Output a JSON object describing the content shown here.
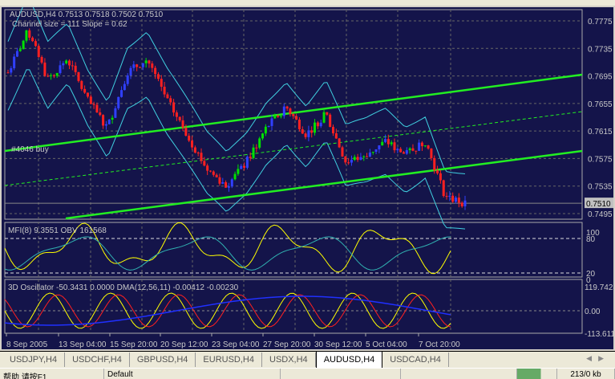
{
  "chart": {
    "header": "AUDUSD,H4  0.7513 0.7518 0.7502 0.7510",
    "subheader": "Channel size = 111 Slope = 0.62",
    "line_label": "#4046 buy",
    "current_price": "0.7510",
    "price_ticks": [
      "0.7775",
      "0.7735",
      "0.7695",
      "0.7655",
      "0.7615",
      "0.7575",
      "0.7535",
      "0.7495"
    ],
    "mfi_header": "MFI(8) 9.3551  OBV 161568",
    "mfi_ticks": [
      "100",
      "80",
      "20",
      "0"
    ],
    "osc_header": "3D Oscillator -50.3431 0.0000  DMA(12,56,11) -0.00412 -0.00230",
    "osc_ticks": [
      "119.7428",
      "0.00",
      "-113.611"
    ],
    "time_ticks": [
      "8 Sep 2005",
      "13 Sep 04:00",
      "15 Sep 20:00",
      "20 Sep 12:00",
      "23 Sep 04:00",
      "27 Sep 20:00",
      "30 Sep 12:00",
      "5 Oct 04:00",
      "7 Oct 20:00"
    ],
    "colors": {
      "bg": "#14144a",
      "up": "#00e000",
      "down": "#ff2020",
      "channel": "#22ee22",
      "band": "#40d0e0",
      "mfi": "#ffff00",
      "obv": "#30b0b0"
    }
  },
  "chart_data": {
    "type": "line",
    "title": "AUDUSD,H4",
    "ylim": [
      0.7495,
      0.7775
    ],
    "close_path": [
      0.77,
      0.776,
      0.769,
      0.772,
      0.766,
      0.762,
      0.77,
      0.772,
      0.766,
      0.761,
      0.756,
      0.7535,
      0.757,
      0.762,
      0.765,
      0.761,
      0.764,
      0.757,
      0.758,
      0.76,
      0.758,
      0.76,
      0.752,
      0.751
    ]
  },
  "tabs": [
    "USDJPY,H4",
    "USDCHF,H4",
    "GBPUSD,H4",
    "EURUSD,H4",
    "USDX,H4",
    "AUDUSD,H4",
    "USDCAD,H4"
  ],
  "active_tab": "AUDUSD,H4",
  "status": {
    "help": "帮助 请按F1",
    "profile": "Default",
    "traffic": "213/0 kb"
  }
}
